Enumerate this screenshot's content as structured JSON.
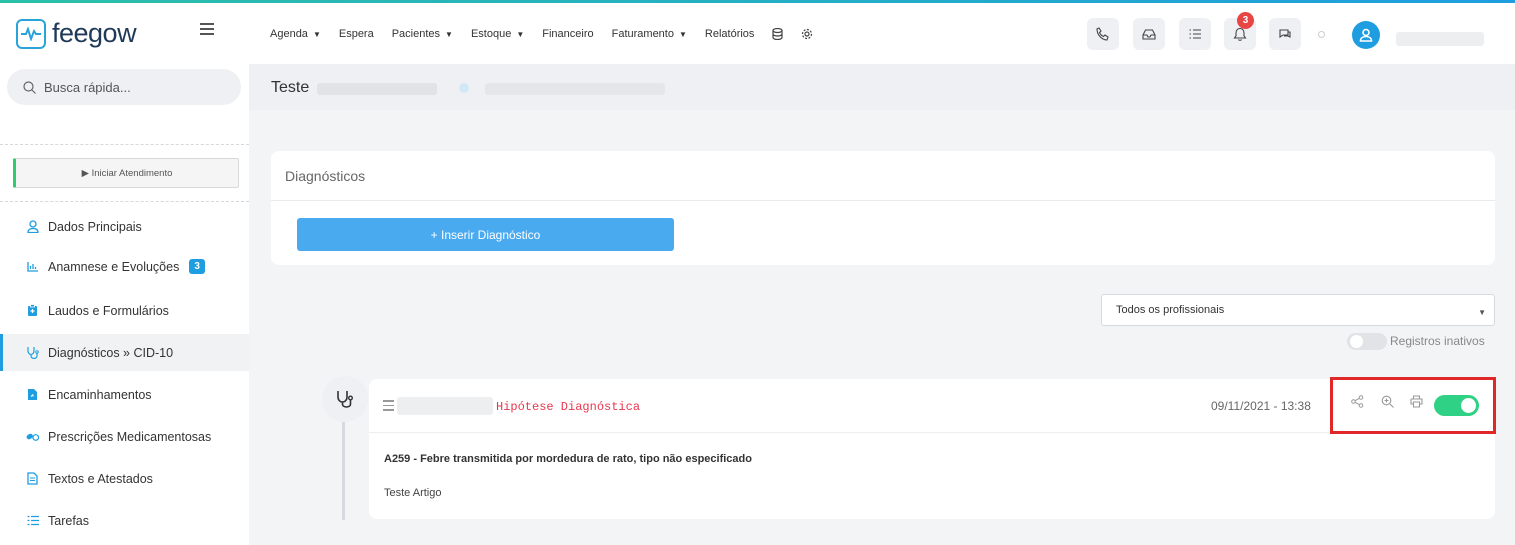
{
  "app": {
    "brand": "feegow"
  },
  "topmenu": [
    {
      "label": "Agenda",
      "caret": true
    },
    {
      "label": "Espera",
      "caret": false
    },
    {
      "label": "Pacientes",
      "caret": true
    },
    {
      "label": "Estoque",
      "caret": true
    },
    {
      "label": "Financeiro",
      "caret": false
    },
    {
      "label": "Faturamento",
      "caret": true
    },
    {
      "label": "Relatórios",
      "caret": false
    }
  ],
  "notifications": {
    "count": "3"
  },
  "sidebar": {
    "search_placeholder": "Busca rápida...",
    "start_button": "▶ Iniciar Atendimento",
    "items": [
      {
        "label": "Dados Principais",
        "icon": "user-icon"
      },
      {
        "label": "Anamnese e Evoluções",
        "icon": "chart-icon",
        "badge": "3"
      },
      {
        "label": "Laudos e Formulários",
        "icon": "clipboard-icon"
      },
      {
        "label": "Diagnósticos » CID-10",
        "icon": "stethoscope-icon",
        "active": true
      },
      {
        "label": "Encaminhamentos",
        "icon": "file-icon"
      },
      {
        "label": "Prescrições Medicamentosas",
        "icon": "pills-icon"
      },
      {
        "label": "Textos e Atestados",
        "icon": "document-icon"
      },
      {
        "label": "Tarefas",
        "icon": "tasks-icon"
      }
    ]
  },
  "header": {
    "title": "Teste"
  },
  "diagnosticos": {
    "title": "Diagnósticos",
    "insert_button": "+ Inserir Diagnóstico"
  },
  "filters": {
    "professional_select": "Todos os profissionais",
    "inactive_label": "Registros inativos"
  },
  "entry": {
    "tag": "Hipótese Diagnóstica",
    "datetime": "09/11/2021 - 13:38",
    "cid": "A259 - Febre transmitida por mordedura de rato, tipo não especificado",
    "note": "Teste Artigo",
    "active": true
  },
  "colors": {
    "accent": "#1e9ee0",
    "primary_button": "#4aaaf0",
    "toggle_on": "#2fd184",
    "highlight": "#e02828",
    "tag": "#e8364e"
  }
}
